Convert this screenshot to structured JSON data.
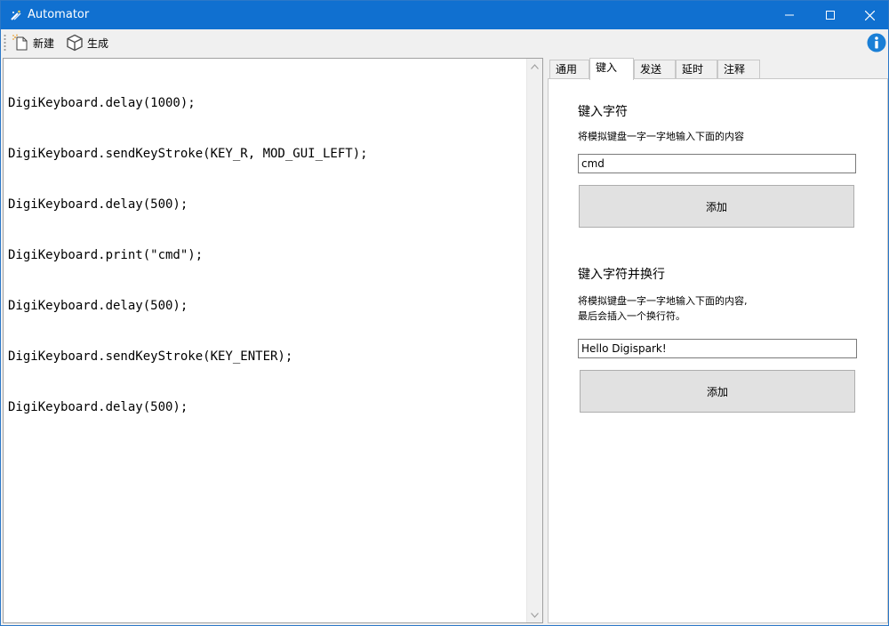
{
  "window": {
    "title": "Automator",
    "accent_color": "#1070d0"
  },
  "toolbar": {
    "new_label": "新建",
    "generate_label": "生成"
  },
  "editor": {
    "lines": [
      "DigiKeyboard.delay(1000);",
      "DigiKeyboard.sendKeyStroke(KEY_R, MOD_GUI_LEFT);",
      "DigiKeyboard.delay(500);",
      "DigiKeyboard.print(\"cmd\");",
      "DigiKeyboard.delay(500);",
      "DigiKeyboard.sendKeyStroke(KEY_ENTER);",
      "DigiKeyboard.delay(500);"
    ]
  },
  "tabs": [
    {
      "label": "通用",
      "active": false
    },
    {
      "label": "键入",
      "active": true
    },
    {
      "label": "发送",
      "active": false
    },
    {
      "label": "延时",
      "active": false
    },
    {
      "label": "注释",
      "active": false
    }
  ],
  "panel": {
    "type_section": {
      "title": "键入字符",
      "description": "将模拟键盘一字一字地输入下面的内容",
      "input_value": "cmd",
      "button_label": "添加"
    },
    "typeline_section": {
      "title": "键入字符并换行",
      "description_line1": "将模拟键盘一字一字地输入下面的内容,",
      "description_line2": "最后会插入一个换行符。",
      "input_value": "Hello Digispark!",
      "button_label": "添加"
    }
  }
}
